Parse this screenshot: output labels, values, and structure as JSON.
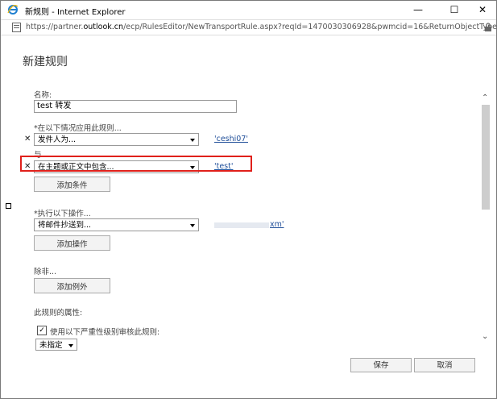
{
  "window": {
    "title": "新规则 - Internet Explorer"
  },
  "address_bar": {
    "url_prefix": "https://partner.",
    "url_domain": "outlook.cn",
    "url_rest": "/ecp/RulesEditor/NewTransportRule.aspx?reqId=1470030306928&pwmcid=16&ReturnObjectType=1"
  },
  "form": {
    "heading": "新建规则",
    "name_label": "名称:",
    "name_value": "test 转发",
    "apply_label": "*在以下情况应用此规则...",
    "conditions": [
      {
        "select": "发件人为...",
        "value": "'ceshi07'"
      },
      {
        "select": "在主题或正文中包含...",
        "value": "'test'"
      }
    ],
    "and_label": "与",
    "add_condition": "添加条件",
    "action_label": "*执行以下操作...",
    "action_select": "将邮件抄送到...",
    "action_value": "xm'",
    "add_action": "添加操作",
    "except_label": "除非...",
    "add_exception": "添加例外",
    "properties_label": "此规则的属性:",
    "audit_checkbox_label": "使用以下严重性级别审核此规则:",
    "audit_checked": true,
    "severity_select": "未指定"
  },
  "footer": {
    "save": "保存",
    "cancel": "取消"
  },
  "colors": {
    "highlight_box": "#e0201b",
    "link": "#1f4e99"
  }
}
